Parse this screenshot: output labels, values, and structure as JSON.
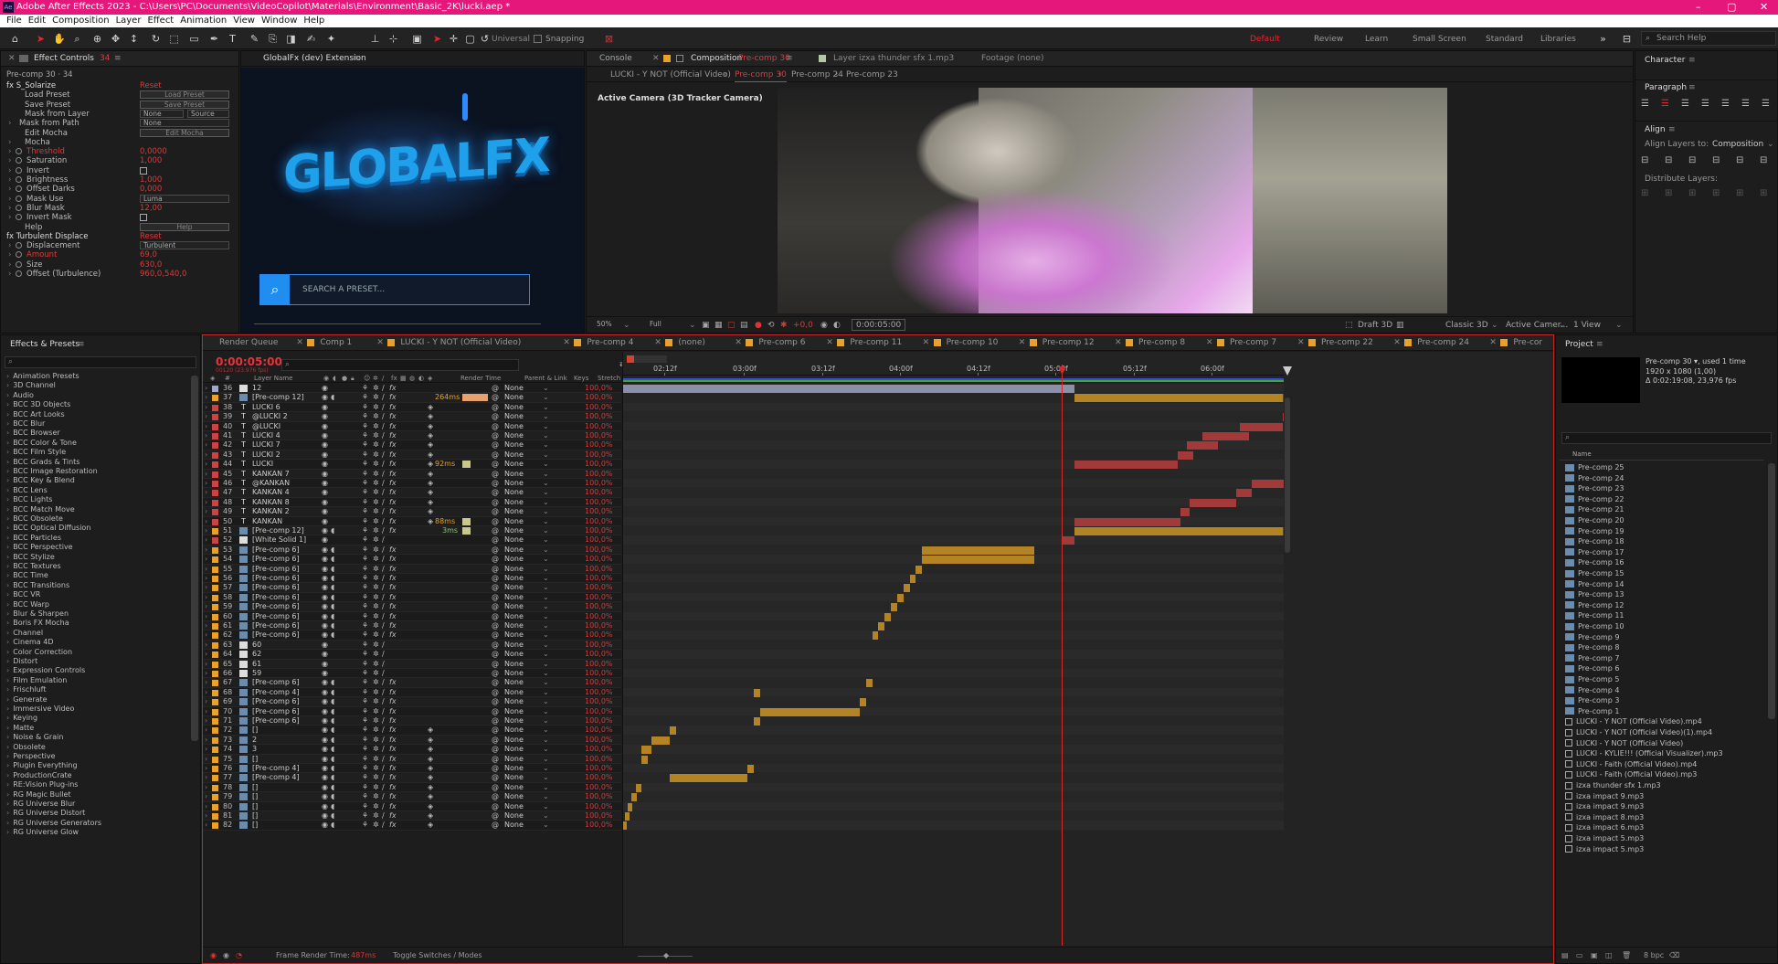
{
  "app": {
    "title": "Adobe After Effects 2023 - C:\\Users\\PC\\Documents\\VideoCopilot\\Materials\\Environment\\Basic_2K\\lucki.aep *",
    "logo": "Ae"
  },
  "menu": [
    "File",
    "Edit",
    "Composition",
    "Layer",
    "Effect",
    "Animation",
    "View",
    "Window",
    "Help"
  ],
  "toolbar": {
    "universal": "Universal",
    "snapping": "Snapping",
    "workspaces": [
      "Default",
      "Review",
      "Learn",
      "Small Screen",
      "Standard",
      "Libraries"
    ],
    "search": "Search Help"
  },
  "effect_controls": {
    "tab": "Effect Controls",
    "tab_count": "34",
    "header": "Pre-comp 30 · 34",
    "rows": [
      {
        "label": "fx  S_Solarize",
        "value": "Reset",
        "kind": "section"
      },
      {
        "label": "Load Preset",
        "value": "Load Preset",
        "kind": "button"
      },
      {
        "label": "Save Preset",
        "value": "Save Preset",
        "kind": "button"
      },
      {
        "label": "Mask from Layer",
        "value": "None",
        "value2": "Source",
        "kind": "dd2"
      },
      {
        "label": "Mask from Path",
        "value": "None",
        "kind": "dd"
      },
      {
        "label": "Edit Mocha",
        "value": "Edit Mocha",
        "kind": "button"
      },
      {
        "label": "Mocha",
        "value": "",
        "kind": "group"
      },
      {
        "label": "Threshold",
        "value": "0,0000",
        "kind": "num"
      },
      {
        "label": "Saturation",
        "value": "1,000",
        "kind": "num"
      },
      {
        "label": "Invert",
        "value": "",
        "kind": "check"
      },
      {
        "label": "Brightness",
        "value": "1,000",
        "kind": "num"
      },
      {
        "label": "Offset Darks",
        "value": "0,000",
        "kind": "num"
      },
      {
        "label": "Mask Use",
        "value": "Luma",
        "kind": "dd"
      },
      {
        "label": "Blur Mask",
        "value": "12,00",
        "kind": "num"
      },
      {
        "label": "Invert Mask",
        "value": "",
        "kind": "check"
      },
      {
        "label": "Help",
        "value": "Help",
        "kind": "button"
      },
      {
        "label": "fx  Turbulent Displace",
        "value": "Reset",
        "kind": "section"
      },
      {
        "label": "Displacement",
        "value": "Turbulent",
        "kind": "dd"
      },
      {
        "label": "Amount",
        "value": "69,0",
        "kind": "num"
      },
      {
        "label": "Size",
        "value": "630,0",
        "kind": "num"
      },
      {
        "label": "Offset (Turbulence)",
        "value": "960,0,540,0",
        "kind": "num"
      }
    ]
  },
  "globalfx": {
    "tab": "GlobalFx (dev) Extension",
    "logo": "GLOBALFX",
    "search_placeholder": "SEARCH A PRESET..."
  },
  "viewer": {
    "tabs": [
      "Console",
      "Composition",
      "Pre-comp 30",
      "Layer izxa thunder sfx 1.mp3",
      "Footage (none)"
    ],
    "sub_tabs": [
      "LUCKI - Y NOT (Official Video)",
      "Pre-comp 30",
      "Pre-comp 24",
      "Pre-comp 23"
    ],
    "camera": "Active Camera (3D Tracker Camera)",
    "bottom": {
      "zoom": "50%",
      "quality": "Full",
      "time": "0:00:05:00",
      "exposure": "+0,0",
      "draft": "Draft 3D",
      "renderer": "Classic 3D",
      "camera": "Active Camer...",
      "view": "1 View"
    }
  },
  "character": {
    "title": "Character",
    "paragraph": "Paragraph",
    "align": "Align",
    "align_to_label": "Align Layers to:",
    "align_to": "Composition",
    "distribute": "Distribute Layers:"
  },
  "effects_presets": {
    "title": "Effects & Presets",
    "items": [
      "Animation Presets",
      "3D Channel",
      "Audio",
      "BCC 3D Objects",
      "BCC Art Looks",
      "BCC Blur",
      "BCC Browser",
      "BCC Color & Tone",
      "BCC Film Style",
      "BCC Grads & Tints",
      "BCC Image Restoration",
      "BCC Key & Blend",
      "BCC Lens",
      "BCC Lights",
      "BCC Match Move",
      "BCC Obsolete",
      "BCC Optical Diffusion",
      "BCC Particles",
      "BCC Perspective",
      "BCC Stylize",
      "BCC Textures",
      "BCC Time",
      "BCC Transitions",
      "BCC VR",
      "BCC Warp",
      "Blur & Sharpen",
      "Boris FX Mocha",
      "Channel",
      "Cinema 4D",
      "Color Correction",
      "Distort",
      "Expression Controls",
      "Film Emulation",
      "Frischluft",
      "Generate",
      "Immersive Video",
      "Keying",
      "Matte",
      "Noise & Grain",
      "Obsolete",
      "Perspective",
      "Plugin Everything",
      "ProductionCrate",
      "RE:Vision Plug-ins",
      "RG Magic Bullet",
      "RG Universe Blur",
      "RG Universe Distort",
      "RG Universe Generators",
      "RG Universe Glow"
    ]
  },
  "timeline": {
    "tabs": [
      "Render Queue",
      "Comp 1",
      "LUCKI - Y NOT (Official Video)",
      "Pre-comp 4",
      "(none)",
      "Pre-comp 6",
      "Pre-comp 11",
      "Pre-comp 10",
      "Pre-comp 12",
      "Pre-comp 8",
      "Pre-comp 7",
      "Pre-comp 22",
      "Pre-comp 24",
      "Pre-cor"
    ],
    "timecode": "0:00:05:00",
    "timecode_sub": "00120 (23.976 fps)",
    "cols": {
      "layer_name": "Layer Name",
      "render_time": "Render Time",
      "parent": "Parent & Link",
      "keys": "Keys",
      "stretch": "Stretch"
    },
    "ruler": [
      "02:12f",
      "03:00f",
      "03:12f",
      "04:00f",
      "04:12f",
      "05:00f",
      "05:12f",
      "06:00f"
    ],
    "footer": {
      "frame_render_label": "Frame Render Time:",
      "frame_render_value": "487ms",
      "toggle": "Toggle Switches / Modes"
    },
    "layers": [
      {
        "n": "36",
        "name": "12",
        "c": "#a3a6c9",
        "t": "s",
        "rt": ""
      },
      {
        "n": "37",
        "name": "[Pre-comp 12]",
        "c": "#e8a22b",
        "t": "c",
        "rt": "264ms"
      },
      {
        "n": "38",
        "name": "LUCKI 6",
        "c": "#c94545",
        "t": "T",
        "rt": ""
      },
      {
        "n": "39",
        "name": "@LUCKI 2",
        "c": "#c94545",
        "t": "T",
        "rt": ""
      },
      {
        "n": "40",
        "name": "@LUCKI",
        "c": "#c94545",
        "t": "T",
        "rt": ""
      },
      {
        "n": "41",
        "name": "LUCKI 4",
        "c": "#c94545",
        "t": "T",
        "rt": ""
      },
      {
        "n": "42",
        "name": "LUCKI 7",
        "c": "#c94545",
        "t": "T",
        "rt": ""
      },
      {
        "n": "43",
        "name": "LUCKI 2",
        "c": "#c94545",
        "t": "T",
        "rt": ""
      },
      {
        "n": "44",
        "name": "LUCKI",
        "c": "#c94545",
        "t": "T",
        "rt": "92ms"
      },
      {
        "n": "45",
        "name": "KANKAN 7",
        "c": "#c94545",
        "t": "T",
        "rt": ""
      },
      {
        "n": "46",
        "name": "@KANKAN",
        "c": "#c94545",
        "t": "T",
        "rt": ""
      },
      {
        "n": "47",
        "name": "KANKAN 4",
        "c": "#c94545",
        "t": "T",
        "rt": ""
      },
      {
        "n": "48",
        "name": "KANKAN 8",
        "c": "#c94545",
        "t": "T",
        "rt": ""
      },
      {
        "n": "49",
        "name": "KANKAN 2",
        "c": "#c94545",
        "t": "T",
        "rt": ""
      },
      {
        "n": "50",
        "name": "KANKAN",
        "c": "#c94545",
        "t": "T",
        "rt": "88ms"
      },
      {
        "n": "51",
        "name": "[Pre-comp 12]",
        "c": "#e8a22b",
        "t": "c",
        "rt": "3ms"
      },
      {
        "n": "52",
        "name": "[White Solid 1]",
        "c": "#c94545",
        "t": "s",
        "rt": ""
      },
      {
        "n": "53",
        "name": "[Pre-comp 6]",
        "c": "#e8a22b",
        "t": "c",
        "rt": ""
      },
      {
        "n": "54",
        "name": "[Pre-comp 6]",
        "c": "#e8a22b",
        "t": "c",
        "rt": ""
      },
      {
        "n": "55",
        "name": "[Pre-comp 6]",
        "c": "#e8a22b",
        "t": "c",
        "rt": ""
      },
      {
        "n": "56",
        "name": "[Pre-comp 6]",
        "c": "#e8a22b",
        "t": "c",
        "rt": ""
      },
      {
        "n": "57",
        "name": "[Pre-comp 6]",
        "c": "#e8a22b",
        "t": "c",
        "rt": ""
      },
      {
        "n": "58",
        "name": "[Pre-comp 6]",
        "c": "#e8a22b",
        "t": "c",
        "rt": ""
      },
      {
        "n": "59",
        "name": "[Pre-comp 6]",
        "c": "#e8a22b",
        "t": "c",
        "rt": ""
      },
      {
        "n": "60",
        "name": "[Pre-comp 6]",
        "c": "#e8a22b",
        "t": "c",
        "rt": ""
      },
      {
        "n": "61",
        "name": "[Pre-comp 6]",
        "c": "#e8a22b",
        "t": "c",
        "rt": ""
      },
      {
        "n": "62",
        "name": "[Pre-comp 6]",
        "c": "#e8a22b",
        "t": "c",
        "rt": ""
      },
      {
        "n": "63",
        "name": "60",
        "c": "#e8a22b",
        "t": "s",
        "rt": ""
      },
      {
        "n": "64",
        "name": "62",
        "c": "#e8a22b",
        "t": "s",
        "rt": ""
      },
      {
        "n": "65",
        "name": "61",
        "c": "#e8a22b",
        "t": "s",
        "rt": ""
      },
      {
        "n": "66",
        "name": "59",
        "c": "#e8a22b",
        "t": "s",
        "rt": ""
      },
      {
        "n": "67",
        "name": "[Pre-comp 6]",
        "c": "#e8a22b",
        "t": "c",
        "rt": ""
      },
      {
        "n": "68",
        "name": "[Pre-comp 4]",
        "c": "#e8a22b",
        "t": "c",
        "rt": ""
      },
      {
        "n": "69",
        "name": "[Pre-comp 6]",
        "c": "#e8a22b",
        "t": "c",
        "rt": ""
      },
      {
        "n": "70",
        "name": "[Pre-comp 6]",
        "c": "#e8a22b",
        "t": "c",
        "rt": ""
      },
      {
        "n": "71",
        "name": "[Pre-comp 6]",
        "c": "#e8a22b",
        "t": "c",
        "rt": ""
      },
      {
        "n": "72",
        "name": "[]",
        "c": "#e8a22b",
        "t": "c",
        "rt": ""
      },
      {
        "n": "73",
        "name": "2",
        "c": "#e8a22b",
        "t": "c",
        "rt": ""
      },
      {
        "n": "74",
        "name": "3",
        "c": "#e8a22b",
        "t": "c",
        "rt": ""
      },
      {
        "n": "75",
        "name": "[]",
        "c": "#e8a22b",
        "t": "c",
        "rt": ""
      },
      {
        "n": "76",
        "name": "[Pre-comp 4]",
        "c": "#e8a22b",
        "t": "c",
        "rt": ""
      },
      {
        "n": "77",
        "name": "[Pre-comp 4]",
        "c": "#e8a22b",
        "t": "c",
        "rt": ""
      },
      {
        "n": "78",
        "name": "[]",
        "c": "#e8a22b",
        "t": "c",
        "rt": ""
      },
      {
        "n": "79",
        "name": "[]",
        "c": "#e8a22b",
        "t": "c",
        "rt": ""
      },
      {
        "n": "80",
        "name": "[]",
        "c": "#e8a22b",
        "t": "c",
        "rt": ""
      },
      {
        "n": "81",
        "name": "[]",
        "c": "#e8a22b",
        "t": "c",
        "rt": ""
      },
      {
        "n": "82",
        "name": "[]",
        "c": "#e8a22b",
        "t": "c",
        "rt": ""
      }
    ],
    "parent_value": "None",
    "stretch_value": "100,0%"
  },
  "project": {
    "title": "Project",
    "selected_name": "Pre-comp 30 ▾",
    "used": ", used 1 time",
    "info1": "1920 x 1080 (1,00)",
    "info2": "Δ 0:02:19:08, 23,976 fps",
    "col_name": "Name",
    "bpc": "8 bpc",
    "items": [
      {
        "name": "Pre-comp 25",
        "kind": "comp"
      },
      {
        "name": "Pre-comp 24",
        "kind": "comp"
      },
      {
        "name": "Pre-comp 23",
        "kind": "comp"
      },
      {
        "name": "Pre-comp 22",
        "kind": "comp"
      },
      {
        "name": "Pre-comp 21",
        "kind": "comp"
      },
      {
        "name": "Pre-comp 20",
        "kind": "comp"
      },
      {
        "name": "Pre-comp 19",
        "kind": "comp"
      },
      {
        "name": "Pre-comp 18",
        "kind": "comp"
      },
      {
        "name": "Pre-comp 17",
        "kind": "comp"
      },
      {
        "name": "Pre-comp 16",
        "kind": "comp"
      },
      {
        "name": "Pre-comp 15",
        "kind": "comp"
      },
      {
        "name": "Pre-comp 14",
        "kind": "comp"
      },
      {
        "name": "Pre-comp 13",
        "kind": "comp"
      },
      {
        "name": "Pre-comp 12",
        "kind": "comp"
      },
      {
        "name": "Pre-comp 11",
        "kind": "comp"
      },
      {
        "name": "Pre-comp 10",
        "kind": "comp"
      },
      {
        "name": "Pre-comp 9",
        "kind": "comp"
      },
      {
        "name": "Pre-comp 8",
        "kind": "comp"
      },
      {
        "name": "Pre-comp 7",
        "kind": "comp"
      },
      {
        "name": "Pre-comp 6",
        "kind": "comp"
      },
      {
        "name": "Pre-comp 5",
        "kind": "comp"
      },
      {
        "name": "Pre-comp 4",
        "kind": "comp"
      },
      {
        "name": "Pre-comp 3",
        "kind": "comp"
      },
      {
        "name": "Pre-comp 1",
        "kind": "comp"
      },
      {
        "name": "LUCKI - Y NOT (Official Video).mp4",
        "kind": "file"
      },
      {
        "name": "LUCKI - Y NOT (Official Video)(1).mp4",
        "kind": "file"
      },
      {
        "name": "LUCKI - Y NOT (Official Video)",
        "kind": "file"
      },
      {
        "name": "LUCKI - KYLIE!!! (Official Visualizer).mp3",
        "kind": "file"
      },
      {
        "name": "LUCKI - Faith (Official Video).mp4",
        "kind": "file"
      },
      {
        "name": "LUCKI - Faith (Official Video).mp3",
        "kind": "file"
      },
      {
        "name": "izxa thunder sfx 1.mp3",
        "kind": "file"
      },
      {
        "name": "izxa impact 9.mp3",
        "kind": "file"
      },
      {
        "name": "izxa impact 9.mp3",
        "kind": "file"
      },
      {
        "name": "izxa impact 8.mp3",
        "kind": "file"
      },
      {
        "name": "izxa impact 6.mp3",
        "kind": "file"
      },
      {
        "name": "izxa impact 5.mp3",
        "kind": "file"
      },
      {
        "name": "izxa impact 5.mp3",
        "kind": "file"
      }
    ]
  },
  "colors": {
    "accent": "#e6177a",
    "timecode": "#e8323b",
    "comp": "#e8a22b",
    "text_layer": "#c94545",
    "playhead": "#d12b2b"
  }
}
